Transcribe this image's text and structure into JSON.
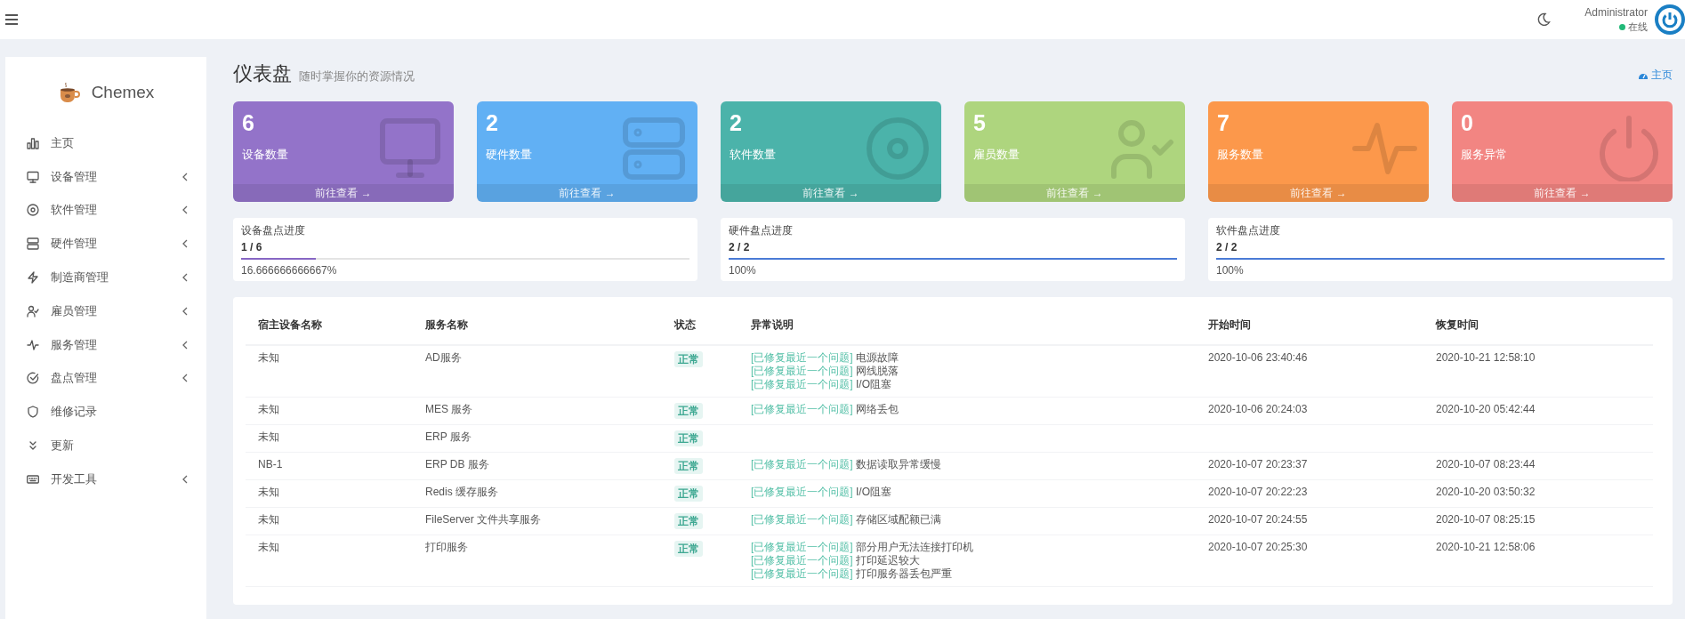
{
  "header": {
    "user_name": "Administrator",
    "status_label": "在线",
    "online": true
  },
  "sidebar": {
    "brand": "Chemex",
    "items": [
      {
        "label": "主页",
        "expandable": false
      },
      {
        "label": "设备管理",
        "expandable": true
      },
      {
        "label": "软件管理",
        "expandable": true
      },
      {
        "label": "硬件管理",
        "expandable": true
      },
      {
        "label": "制造商管理",
        "expandable": true
      },
      {
        "label": "雇员管理",
        "expandable": true
      },
      {
        "label": "服务管理",
        "expandable": true
      },
      {
        "label": "盘点管理",
        "expandable": true
      },
      {
        "label": "维修记录",
        "expandable": false
      },
      {
        "label": "更新",
        "expandable": false
      },
      {
        "label": "开发工具",
        "expandable": true
      }
    ]
  },
  "page": {
    "title": "仪表盘",
    "subtitle": "随时掌握你的资源情况",
    "breadcrumb": "主页"
  },
  "stat_cards": [
    {
      "value": "6",
      "label": "设备数量",
      "link": "前往查看 →",
      "color": "#9373c9"
    },
    {
      "value": "2",
      "label": "硬件数量",
      "link": "前往查看 →",
      "color": "#61b0f4"
    },
    {
      "value": "2",
      "label": "软件数量",
      "link": "前往查看 →",
      "color": "#4bb3aa"
    },
    {
      "value": "5",
      "label": "雇员数量",
      "link": "前往查看 →",
      "color": "#aed57e"
    },
    {
      "value": "7",
      "label": "服务数量",
      "link": "前往查看 →",
      "color": "#fc984b"
    },
    {
      "value": "0",
      "label": "服务异常",
      "link": "前往查看 →",
      "color": "#f28582"
    }
  ],
  "progress_cards": [
    {
      "title": "设备盘点进度",
      "count": "1 / 6",
      "level": 0.1667,
      "percent": "16.666666666667%",
      "color": "#8766c4"
    },
    {
      "title": "硬件盘点进度",
      "count": "2 / 2",
      "level": 1,
      "percent": "100%",
      "color": "#4a7bd6"
    },
    {
      "title": "软件盘点进度",
      "count": "2 / 2",
      "level": 1,
      "percent": "100%",
      "color": "#4a7bd6"
    }
  ],
  "table": {
    "columns": [
      "宿主设备名称",
      "服务名称",
      "状态",
      "异常说明",
      "开始时间",
      "恢复时间"
    ],
    "rows": [
      {
        "host": "未知",
        "service": "AD服务",
        "status": "正常",
        "issues": [
          {
            "tag": "[已修复最近一个问题]",
            "text": "电源故障"
          },
          {
            "tag": "[已修复最近一个问题]",
            "text": "网线脱落"
          },
          {
            "tag": "[已修复最近一个问题]",
            "text": "I/O阻塞"
          }
        ],
        "start": "2020-10-06 23:40:46",
        "recovered": "2020-10-21 12:58:10"
      },
      {
        "host": "未知",
        "service": "MES 服务",
        "status": "正常",
        "issues": [
          {
            "tag": "[已修复最近一个问题]",
            "text": "网络丢包"
          }
        ],
        "start": "2020-10-06 20:24:03",
        "recovered": "2020-10-20 05:42:44"
      },
      {
        "host": "未知",
        "service": "ERP 服务",
        "status": "正常",
        "issues": []
      },
      {
        "host": "NB-1",
        "service": "ERP DB 服务",
        "status": "正常",
        "issues": [
          {
            "tag": "[已修复最近一个问题]",
            "text": "数据读取异常缓慢"
          }
        ],
        "start": "2020-10-07 20:23:37",
        "recovered": "2020-10-07 08:23:44"
      },
      {
        "host": "未知",
        "service": "Redis 缓存服务",
        "status": "正常",
        "issues": [
          {
            "tag": "[已修复最近一个问题]",
            "text": "I/O阻塞"
          }
        ],
        "start": "2020-10-07 20:22:23",
        "recovered": "2020-10-20 03:50:32"
      },
      {
        "host": "未知",
        "service": "FileServer 文件共享服务",
        "status": "正常",
        "issues": [
          {
            "tag": "[已修复最近一个问题]",
            "text": "存储区域配额已满"
          }
        ],
        "start": "2020-10-07 20:24:55",
        "recovered": "2020-10-07 08:25:15"
      },
      {
        "host": "未知",
        "service": "打印服务",
        "status": "正常",
        "issues": [
          {
            "tag": "[已修复最近一个问题]",
            "text": "部分用户无法连接打印机"
          },
          {
            "tag": "[已修复最近一个问题]",
            "text": "打印延迟较大"
          },
          {
            "tag": "[已修复最近一个问题]",
            "text": "打印服务器丢包严重"
          }
        ],
        "start": "2020-10-07 20:25:30",
        "recovered": "2020-10-21 12:58:06"
      }
    ]
  }
}
